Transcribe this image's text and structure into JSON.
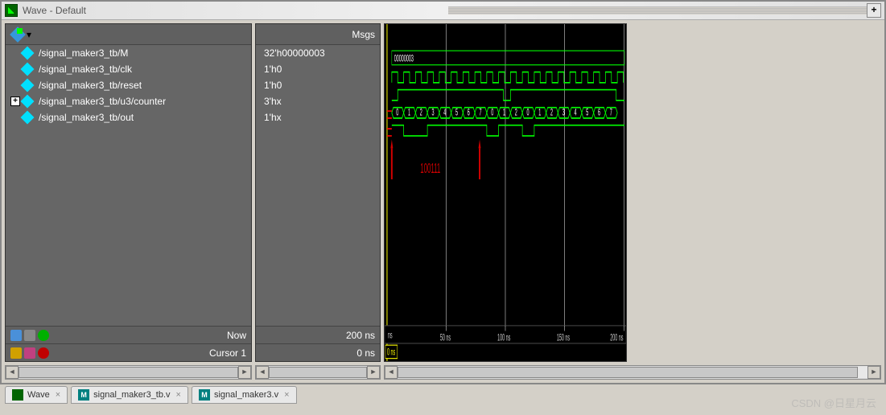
{
  "window": {
    "title": "Wave - Default"
  },
  "headers": {
    "msgs": "Msgs"
  },
  "signals": [
    {
      "name": "/signal_maker3_tb/M",
      "value": "32'h00000003",
      "expandable": false
    },
    {
      "name": "/signal_maker3_tb/clk",
      "value": "1'h0",
      "expandable": false
    },
    {
      "name": "/signal_maker3_tb/reset",
      "value": "1'h0",
      "expandable": false
    },
    {
      "name": "/signal_maker3_tb/u3/counter",
      "value": "3'hx",
      "expandable": true
    },
    {
      "name": "/signal_maker3_tb/out",
      "value": "1'hx",
      "expandable": false
    }
  ],
  "bottom": {
    "now_label": "Now",
    "now_value": "200 ns",
    "cursor_label": "Cursor 1",
    "cursor_value": "0 ns",
    "ns_box": "0 ns",
    "ruler_ns": "ns"
  },
  "timescale": [
    "50 ns",
    "100 ns",
    "150 ns",
    "200 ns"
  ],
  "waveform": {
    "bus_M": "00000003",
    "counter_seq": [
      "0",
      "1",
      "2",
      "3",
      "4",
      "5",
      "6",
      "7",
      "0",
      "1",
      "2",
      "0",
      "1",
      "2",
      "3",
      "4",
      "5",
      "6",
      "7"
    ]
  },
  "annotation": {
    "text": "100111"
  },
  "tabs": [
    {
      "label": "Wave",
      "type": "wave"
    },
    {
      "label": "signal_maker3_tb.v",
      "type": "m"
    },
    {
      "label": "signal_maker3.v",
      "type": "m"
    }
  ],
  "watermark": "CSDN @日星月云",
  "icons": {
    "plus": "+",
    "dropdown": "▾",
    "close": "×",
    "left": "◄",
    "right": "►",
    "m": "M"
  }
}
